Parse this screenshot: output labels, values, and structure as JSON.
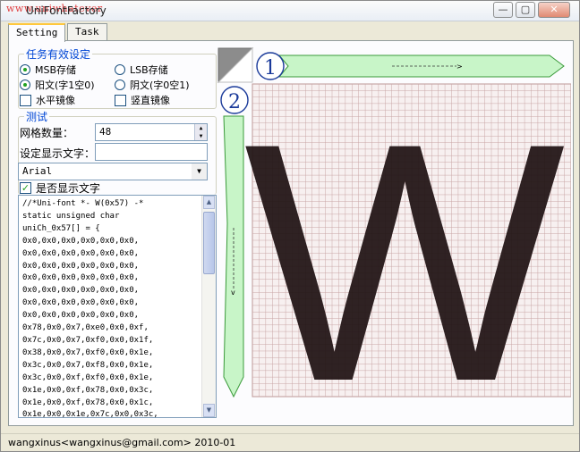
{
  "window": {
    "title": "UniFontFactory",
    "title_watermark": "www.uniwhatever",
    "buttons": {
      "minimize": "—",
      "maximize": "▢",
      "close": "✕"
    }
  },
  "tabs": [
    {
      "label": "Setting",
      "active": true
    },
    {
      "label": "Task",
      "active": false
    }
  ],
  "settings_group": {
    "legend": "任务有效设定",
    "msb": "MSB存储",
    "lsb": "LSB存储",
    "positive": "阳文(字1空0)",
    "negative": "阴文(字0空1)",
    "h_mirror": "水平镜像",
    "v_mirror": "竖直镜像"
  },
  "test_group": {
    "legend": "测试",
    "grid_label": "网格数量：",
    "grid_value": "48",
    "text_label": "设定显示文字：",
    "text_value": "",
    "font_value": "Arial",
    "show_text_label": "是否显示文字"
  },
  "code_lines": [
    "//*Uni-font *- W(0x57) -*",
    "static unsigned char",
    "uniCh_0x57[] = {",
    "0x0,0x0,0x0,0x0,0x0,0x0,",
    "0x0,0x0,0x0,0x0,0x0,0x0,",
    "0x0,0x0,0x0,0x0,0x0,0x0,",
    "0x0,0x0,0x0,0x0,0x0,0x0,",
    "0x0,0x0,0x0,0x0,0x0,0x0,",
    "0x0,0x0,0x0,0x0,0x0,0x0,",
    "0x0,0x0,0x0,0x0,0x0,0x0,",
    "0x78,0x0,0x7,0xe0,0x0,0xf,",
    "0x7c,0x0,0x7,0xf0,0x0,0x1f,",
    "0x38,0x0,0x7,0xf0,0x0,0x1e,",
    "0x3c,0x0,0x7,0xf8,0x0,0x1e,",
    "0x3c,0x0,0xf,0xf0,0x0,0x1e,",
    "0x1e,0x0,0xf,0x78,0x0,0x3c,",
    "0x1e,0x0,0xf,0x78,0x0,0x1c,",
    "0x1e,0x0,0x1e,0x7c,0x0,0x3c,"
  ],
  "canvas": {
    "glyph": "W",
    "marker_1": "①",
    "marker_2": "②",
    "accent": "#c8f5c8",
    "accent_stroke": "#3a9a3a"
  },
  "status": {
    "text": "wangxinus<wangxinus@gmail.com> 2010-01"
  }
}
